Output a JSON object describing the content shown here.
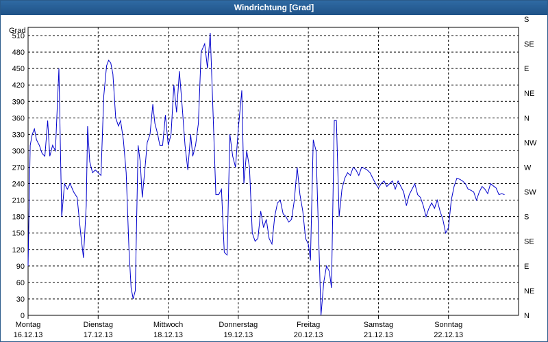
{
  "window": {
    "title": "Windrichtung [Grad]"
  },
  "chart_data": {
    "type": "line",
    "ylabel": "Grad",
    "ylim": [
      0,
      525
    ],
    "grid": true,
    "y_ticks": [
      0,
      30,
      60,
      90,
      120,
      150,
      180,
      210,
      240,
      270,
      300,
      330,
      360,
      390,
      420,
      450,
      480,
      510
    ],
    "y2_labels": [
      "N",
      "NE",
      "E",
      "SE",
      "S",
      "SW",
      "W",
      "NW",
      "N",
      "NE",
      "E",
      "SE",
      "S"
    ],
    "x_ticks": [
      {
        "day": "Montag",
        "date": "16.12.13"
      },
      {
        "day": "Dienstag",
        "date": "17.12.13"
      },
      {
        "day": "Mittwoch",
        "date": "18.12.13"
      },
      {
        "day": "Donnerstag",
        "date": "19.12.13"
      },
      {
        "day": "Freitag",
        "date": "20.12.13"
      },
      {
        "day": "Samstag",
        "date": "21.12.13"
      },
      {
        "day": "Sonntag",
        "date": "22.12.13"
      }
    ],
    "xlim": [
      0,
      7
    ],
    "series": [
      {
        "color": "#0000cc",
        "points": [
          [
            0.0,
            90
          ],
          [
            0.03,
            310
          ],
          [
            0.06,
            330
          ],
          [
            0.09,
            340
          ],
          [
            0.12,
            320
          ],
          [
            0.16,
            310
          ],
          [
            0.2,
            295
          ],
          [
            0.24,
            290
          ],
          [
            0.28,
            355
          ],
          [
            0.31,
            290
          ],
          [
            0.35,
            310
          ],
          [
            0.39,
            300
          ],
          [
            0.44,
            450
          ],
          [
            0.48,
            180
          ],
          [
            0.52,
            240
          ],
          [
            0.56,
            230
          ],
          [
            0.6,
            240
          ],
          [
            0.65,
            225
          ],
          [
            0.7,
            215
          ],
          [
            0.75,
            150
          ],
          [
            0.79,
            105
          ],
          [
            0.83,
            200
          ],
          [
            0.85,
            345
          ],
          [
            0.88,
            280
          ],
          [
            0.92,
            260
          ],
          [
            0.96,
            265
          ],
          [
            1.0,
            260
          ],
          [
            1.04,
            255
          ],
          [
            1.08,
            400
          ],
          [
            1.12,
            455
          ],
          [
            1.15,
            465
          ],
          [
            1.18,
            460
          ],
          [
            1.21,
            440
          ],
          [
            1.25,
            360
          ],
          [
            1.29,
            345
          ],
          [
            1.32,
            355
          ],
          [
            1.36,
            320
          ],
          [
            1.4,
            260
          ],
          [
            1.44,
            120
          ],
          [
            1.47,
            50
          ],
          [
            1.5,
            30
          ],
          [
            1.53,
            45
          ],
          [
            1.57,
            310
          ],
          [
            1.6,
            280
          ],
          [
            1.63,
            215
          ],
          [
            1.67,
            270
          ],
          [
            1.7,
            315
          ],
          [
            1.74,
            330
          ],
          [
            1.78,
            385
          ],
          [
            1.81,
            350
          ],
          [
            1.85,
            330
          ],
          [
            1.88,
            310
          ],
          [
            1.92,
            310
          ],
          [
            1.96,
            365
          ],
          [
            2.0,
            310
          ],
          [
            2.04,
            330
          ],
          [
            2.08,
            420
          ],
          [
            2.12,
            370
          ],
          [
            2.16,
            445
          ],
          [
            2.2,
            380
          ],
          [
            2.24,
            310
          ],
          [
            2.28,
            265
          ],
          [
            2.32,
            330
          ],
          [
            2.35,
            290
          ],
          [
            2.39,
            310
          ],
          [
            2.43,
            350
          ],
          [
            2.47,
            480
          ],
          [
            2.52,
            495
          ],
          [
            2.56,
            450
          ],
          [
            2.6,
            515
          ],
          [
            2.64,
            370
          ],
          [
            2.68,
            220
          ],
          [
            2.72,
            220
          ],
          [
            2.76,
            230
          ],
          [
            2.8,
            115
          ],
          [
            2.84,
            110
          ],
          [
            2.88,
            330
          ],
          [
            2.92,
            290
          ],
          [
            2.96,
            270
          ],
          [
            3.0,
            340
          ],
          [
            3.05,
            410
          ],
          [
            3.08,
            240
          ],
          [
            3.12,
            300
          ],
          [
            3.16,
            270
          ],
          [
            3.2,
            150
          ],
          [
            3.24,
            135
          ],
          [
            3.28,
            140
          ],
          [
            3.32,
            190
          ],
          [
            3.36,
            160
          ],
          [
            3.4,
            175
          ],
          [
            3.44,
            140
          ],
          [
            3.48,
            130
          ],
          [
            3.52,
            180
          ],
          [
            3.56,
            205
          ],
          [
            3.6,
            210
          ],
          [
            3.64,
            185
          ],
          [
            3.68,
            180
          ],
          [
            3.72,
            170
          ],
          [
            3.76,
            175
          ],
          [
            3.8,
            210
          ],
          [
            3.84,
            270
          ],
          [
            3.88,
            220
          ],
          [
            3.92,
            190
          ],
          [
            3.96,
            140
          ],
          [
            4.0,
            130
          ],
          [
            4.03,
            100
          ],
          [
            4.07,
            320
          ],
          [
            4.11,
            300
          ],
          [
            4.15,
            130
          ],
          [
            4.18,
            0
          ],
          [
            4.22,
            60
          ],
          [
            4.26,
            90
          ],
          [
            4.3,
            80
          ],
          [
            4.33,
            50
          ],
          [
            4.37,
            355
          ],
          [
            4.4,
            355
          ],
          [
            4.44,
            180
          ],
          [
            4.48,
            230
          ],
          [
            4.52,
            250
          ],
          [
            4.56,
            260
          ],
          [
            4.6,
            255
          ],
          [
            4.64,
            270
          ],
          [
            4.68,
            265
          ],
          [
            4.72,
            255
          ],
          [
            4.76,
            270
          ],
          [
            4.8,
            268
          ],
          [
            4.84,
            265
          ],
          [
            4.88,
            260
          ],
          [
            4.92,
            250
          ],
          [
            4.96,
            240
          ],
          [
            5.0,
            232
          ],
          [
            5.04,
            240
          ],
          [
            5.08,
            245
          ],
          [
            5.12,
            235
          ],
          [
            5.16,
            240
          ],
          [
            5.2,
            245
          ],
          [
            5.24,
            230
          ],
          [
            5.28,
            245
          ],
          [
            5.32,
            235
          ],
          [
            5.36,
            225
          ],
          [
            5.4,
            200
          ],
          [
            5.44,
            220
          ],
          [
            5.48,
            230
          ],
          [
            5.52,
            240
          ],
          [
            5.56,
            220
          ],
          [
            5.6,
            215
          ],
          [
            5.64,
            200
          ],
          [
            5.68,
            180
          ],
          [
            5.72,
            195
          ],
          [
            5.76,
            205
          ],
          [
            5.8,
            195
          ],
          [
            5.84,
            210
          ],
          [
            5.88,
            190
          ],
          [
            5.92,
            175
          ],
          [
            5.96,
            150
          ],
          [
            6.0,
            160
          ],
          [
            6.04,
            210
          ],
          [
            6.08,
            235
          ],
          [
            6.12,
            250
          ],
          [
            6.16,
            248
          ],
          [
            6.2,
            245
          ],
          [
            6.24,
            240
          ],
          [
            6.28,
            230
          ],
          [
            6.32,
            228
          ],
          [
            6.36,
            225
          ],
          [
            6.4,
            210
          ],
          [
            6.44,
            225
          ],
          [
            6.48,
            235
          ],
          [
            6.52,
            230
          ],
          [
            6.56,
            222
          ],
          [
            6.6,
            240
          ],
          [
            6.64,
            236
          ],
          [
            6.68,
            232
          ],
          [
            6.72,
            220
          ],
          [
            6.76,
            222
          ],
          [
            6.8,
            220
          ]
        ]
      }
    ]
  }
}
